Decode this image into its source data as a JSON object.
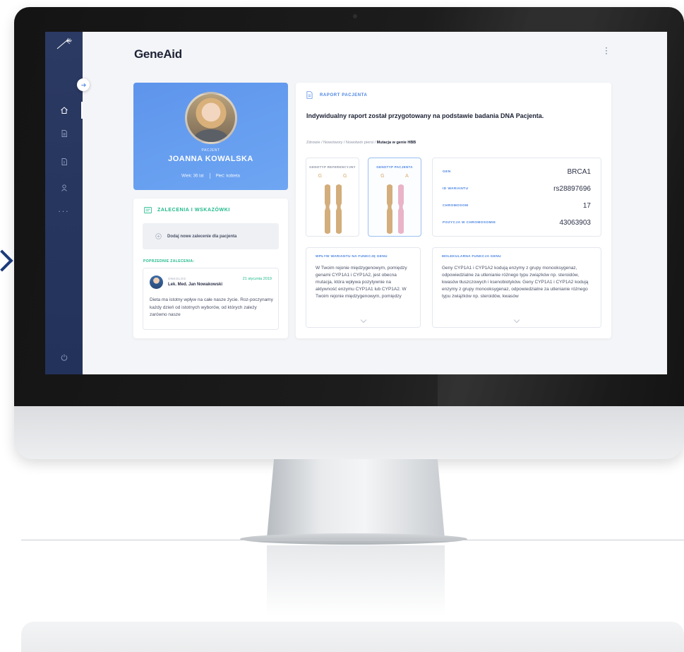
{
  "app": {
    "title": "GeneAid"
  },
  "colors": {
    "sidebar": "#2b3a63",
    "accent_blue": "#4a84e2",
    "accent_green": "#1fb98a",
    "patient_card": "#5e95ec",
    "chromosome_tan": "#d3ad7b",
    "chromosome_pink": "#eab3c8"
  },
  "sidebar": {
    "logo_icon": "dandelion-seed-icon",
    "items": [
      {
        "icon": "home-icon",
        "active": true
      },
      {
        "icon": "document-icon",
        "active": false
      },
      {
        "icon": "report-icon",
        "active": false
      },
      {
        "icon": "user-icon",
        "active": false
      }
    ],
    "more": "...",
    "logout_icon": "power-icon"
  },
  "patient": {
    "label": "PACJENT",
    "name": "JOANNA KOWALSKA",
    "age": "Wiek: 36 lat",
    "sex": "Płeć: kobieta"
  },
  "recommendations": {
    "title": "ZALECENIA I WSKAZÓWKI",
    "add_label": "Dodaj nowe zalecenie dla pacjenta",
    "previous_title": "POPRZEDNIE ZALECENIA:",
    "note": {
      "role": "ONKOLOG",
      "doctor": "Lek. Med. Jan Nowakowski",
      "date": "21 stycznia 2019",
      "text": "Dieta ma istotny wpływ na całe nasze życie. Roz-poczynamy każdy dzień od istotnych wyborów, od których zależy zarówno nasze"
    }
  },
  "report": {
    "label": "RAPORT PACJENTA",
    "subtitle": "Indywidualny raport został przygotowany na podstawie badania DNA Pacjenta.",
    "breadcrumb": {
      "path": "Zdrowie / Nowotwory / Nowotwór piersi / ",
      "current": "Mutacja w genie HBB"
    },
    "genotype_reference": {
      "title": "GENOTYP REFERENCYJNY",
      "alleles": "G G"
    },
    "genotype_patient": {
      "title": "GENOTYP PACJENTA",
      "alleles": "G A"
    },
    "gene_info": {
      "gene_label": "GEN",
      "gene_value": "BRCA1",
      "variant_label": "ID WARIANTU",
      "variant_value": "rs28897696",
      "chromosome_label": "CHROMOSOM",
      "chromosome_value": "17",
      "position_label": "POZYCJA W CHROMOSOMIE",
      "position_value": "43063903"
    },
    "variant_effect": {
      "title": "WPŁYW WARIANTU NA FUNKCJĘ GENU",
      "text": "W Twoim rejonie międzygenowym, pomiędzy genami CYP1A1 i CYP1A2, jest obecna mutacja, która wpływa pozytywnie na aktywność enzymu CYP1A1 lub CYP1A2. W Twoim rejonie międzygenowym, pomiędzy"
    },
    "molecular_function": {
      "title": "MOLEKULARNA FUNKCJA GENU",
      "text": "Geny CYP1A1 i CYP1A2 kodują enzymy z grupy monooksygenaz, odpowiedzialne za utlenianie różnego typu związków np. steroidów, kwasów tłuszczowych i ksenobiotyków. Geny CYP1A1 i CYP1A2 kodują enzymy z grupy monooksygenaz, odpowiedzialne za utlenianie różnego typu związków np. steroidów, kwasów"
    }
  }
}
